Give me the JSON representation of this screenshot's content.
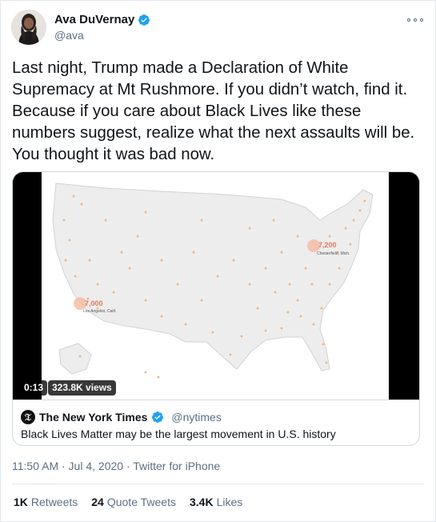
{
  "author": {
    "display_name": "Ava DuVernay",
    "handle": "@ava",
    "verified": true
  },
  "tweet": {
    "text_lines": [
      "Last night, Trump made a Declaration of White",
      "Supremacy at Mt Rushmore. If you didn’t watch, find it.",
      "Because if you care about Black Lives like these",
      "numbers suggest, realize what the next assaults will be.",
      "You thought it was bad now."
    ]
  },
  "video": {
    "timestamp": "0:13",
    "views": "323.8K views",
    "map": {
      "label_ny": "7,200",
      "label_ny_place": "Chesterfield, Mich.",
      "label_la": "7,000",
      "label_la_place": "Los Angeles, Calif."
    }
  },
  "quote": {
    "logo_icon": "nyt-logo",
    "name": "The New York Times",
    "handle": "@nytimes",
    "text": "Black Lives Matter may be the largest movement in U.S. history"
  },
  "meta": {
    "line": "11:50 AM · Jul 4, 2020 · Twitter for iPhone"
  },
  "stats": {
    "retweets_count": "1K",
    "retweets_label": "Retweets",
    "quotes_count": "24",
    "quotes_label": "Quote Tweets",
    "likes_count": "3.4K",
    "likes_label": "Likes"
  },
  "colors": {
    "accent": "#1da1f2",
    "muted": "#5b7083",
    "dot": "#f2b27a"
  }
}
